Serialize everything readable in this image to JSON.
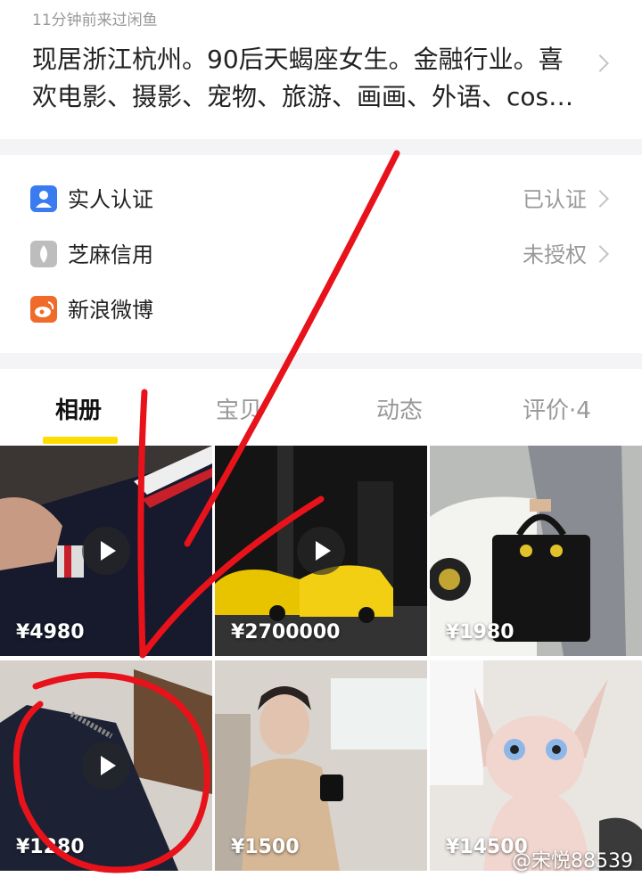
{
  "profile": {
    "last_seen": "11分钟前来过闲鱼",
    "bio": "现居浙江杭州。90后天蝎座女生。金融行业。喜欢电影、摄影、宠物、旅游、画画、外语、cos…"
  },
  "verifications": [
    {
      "label": "实人认证",
      "status": "已认证",
      "icon": "identity-verify-icon",
      "color": "#3a7bf0"
    },
    {
      "label": "芝麻信用",
      "status": "未授权",
      "icon": "sesame-credit-icon",
      "color": "#b8b8b8"
    },
    {
      "label": "新浪微博",
      "status": "",
      "icon": "weibo-icon",
      "color": "#f06a2a"
    }
  ],
  "tabs": [
    {
      "label": "相册",
      "active": true
    },
    {
      "label": "宝贝",
      "active": false
    },
    {
      "label": "动态",
      "active": false
    },
    {
      "label": "评价·4",
      "active": false
    }
  ],
  "photos": [
    {
      "price": "¥4980",
      "subject": "wallet-photo",
      "video": true
    },
    {
      "price": "¥2700000",
      "subject": "sports-cars-photo",
      "video": true
    },
    {
      "price": "¥1980",
      "subject": "handbag-photo",
      "video": false
    },
    {
      "price": "¥1280",
      "subject": "lv-wallet-photo",
      "video": true
    },
    {
      "price": "¥1500",
      "subject": "woman-in-car-photo",
      "video": false
    },
    {
      "price": "¥14500",
      "subject": "sphynx-cat-photo",
      "video": false
    }
  ],
  "watermark": "@宋悦88539",
  "colors": {
    "accent": "#ffdd00",
    "annotation": "#e8121b"
  }
}
